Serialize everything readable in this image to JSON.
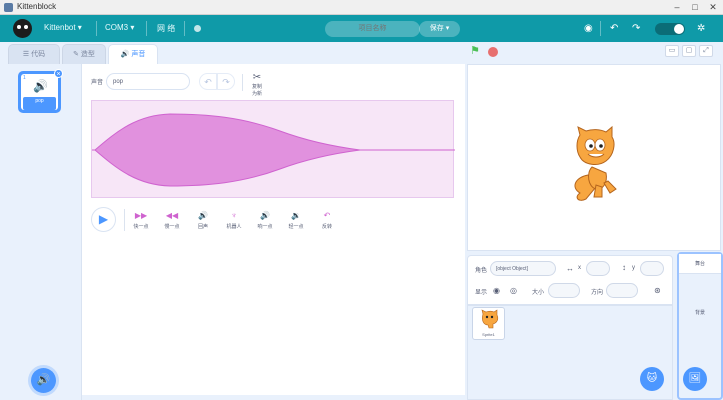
{
  "window": {
    "title": "Kittenblock"
  },
  "menubar": {
    "items": [
      "Kittenbot ▾",
      "COM3 ▾",
      "网 络"
    ],
    "project_placeholder": "项目名称",
    "save_label": "保存 ▾"
  },
  "tabs": [
    {
      "label": "☰ 代码"
    },
    {
      "label": "✎ 造型"
    },
    {
      "label": "🔊 声音"
    }
  ],
  "sound": {
    "index": "1",
    "name": "pop",
    "name_label": "声音",
    "copy_new_label": "复制为新"
  },
  "effects": [
    {
      "icon": "▶▶",
      "label": "快一点"
    },
    {
      "icon": "◀◀",
      "label": "慢一点"
    },
    {
      "icon": "🔊",
      "label": "回声"
    },
    {
      "icon": "♆",
      "label": "机器人"
    },
    {
      "icon": "🔊",
      "label": "响一点"
    },
    {
      "icon": "🔉",
      "label": "轻一点"
    },
    {
      "icon": "↶",
      "label": "反转"
    }
  ],
  "sprite_info": {
    "sprite_label": "角色",
    "sprite_value": "[object Object]",
    "x_label": "x",
    "y_label": "y",
    "show_label": "显示",
    "size_label": "大小",
    "direction_label": "方向"
  },
  "sprite_tile_name": "Sprite1",
  "stage_panel": {
    "header": "舞台",
    "text": "背景"
  }
}
